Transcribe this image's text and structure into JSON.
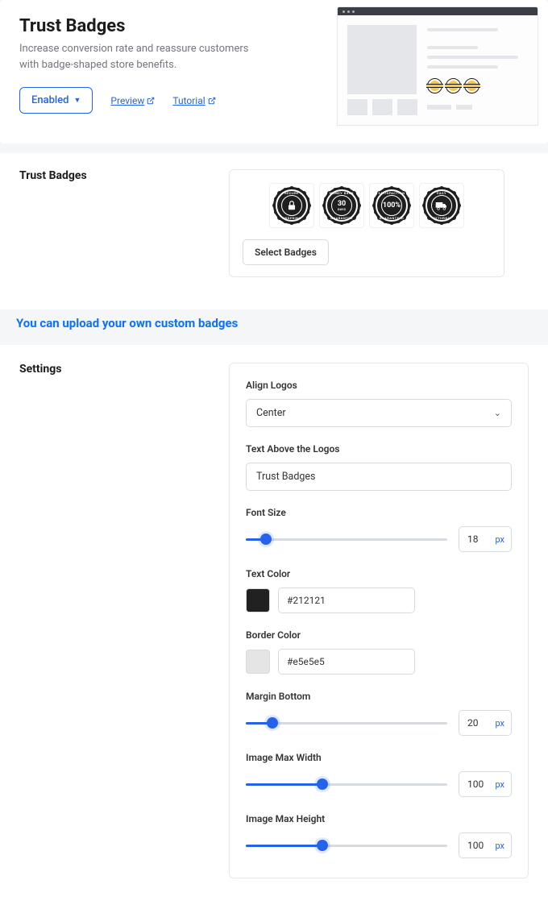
{
  "header": {
    "title": "Trust Badges",
    "description": "Increase conversion rate and reassure customers with badge-shaped store benefits.",
    "enabled_label": "Enabled",
    "preview_label": "Preview",
    "tutorial_label": "Tutorial"
  },
  "badges_section": {
    "title": "Trust Badges",
    "select_button": "Select Badges",
    "badges": [
      {
        "top": "SECURE",
        "center_icon": "lock",
        "bottom": "ORDERING"
      },
      {
        "top": "MONEY BACK",
        "center_text": "30",
        "center_sub": "DAYS",
        "bottom": "GUARANTEE"
      },
      {
        "top": "SATISFACTION",
        "center_text": "100%",
        "bottom": "GUARANTEED"
      },
      {
        "top": "EASY",
        "center_icon": "truck",
        "bottom": "RETURNS"
      }
    ]
  },
  "annotation": "You can upload your own custom badges",
  "settings": {
    "title": "Settings",
    "align_logos": {
      "label": "Align Logos",
      "value": "Center"
    },
    "text_above": {
      "label": "Text Above the Logos",
      "value": "Trust Badges"
    },
    "font_size": {
      "label": "Font Size",
      "value": "18",
      "unit": "px",
      "percent": 10
    },
    "text_color": {
      "label": "Text Color",
      "value": "#212121",
      "swatch": "#212121"
    },
    "border_color": {
      "label": "Border Color",
      "value": "#e5e5e5",
      "swatch": "#e5e5e5"
    },
    "margin_bottom": {
      "label": "Margin Bottom",
      "value": "20",
      "unit": "px",
      "percent": 13
    },
    "image_max_width": {
      "label": "Image Max Width",
      "value": "100",
      "unit": "px",
      "percent": 38
    },
    "image_max_height": {
      "label": "Image Max Height",
      "value": "100",
      "unit": "px",
      "percent": 38
    }
  }
}
